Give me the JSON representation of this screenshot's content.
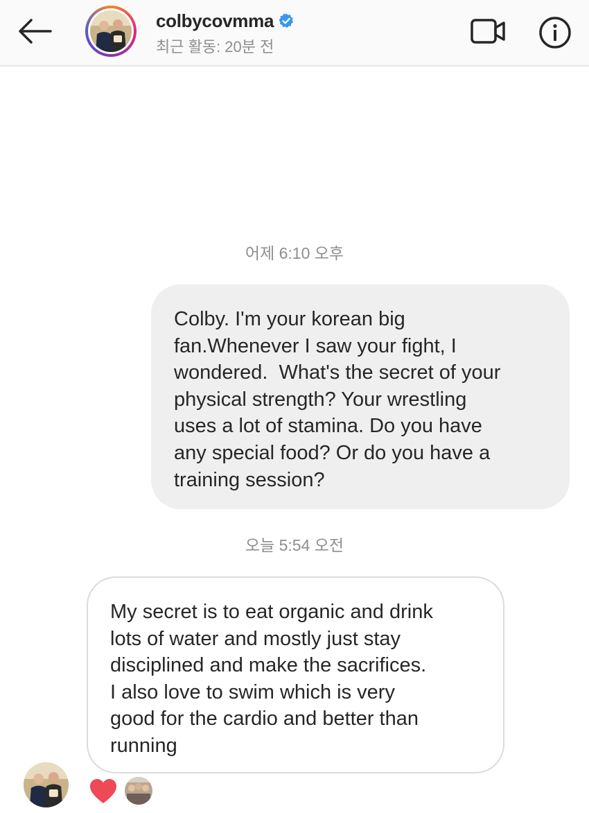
{
  "header": {
    "username": "colbycovmma",
    "verified": true,
    "activity": "최근 활동: 20분 전",
    "icons": {
      "back": "arrow-left-icon",
      "video": "video-call-icon",
      "info": "info-icon",
      "verified": "verified-badge-icon"
    }
  },
  "conversation": {
    "timestamp_1": "어제 6:10 오후",
    "sent_message": "Colby. I'm your korean big\nfan.Whenever I saw your fight, I\nwondered.  What's the secret of your\nphysical strength? Your wrestling\nuses a lot of stamina. Do you have\nany special food? Or do you have a\ntraining session?",
    "timestamp_2": "오늘 5:54 오전",
    "received_message": "My secret is to eat organic and drink\nlots of water and mostly just stay\ndisciplined and make the sacrifices.\nI also love to swim which is very\ngood for the cardio and better than\nrunning",
    "reaction": "heart-icon"
  },
  "colors": {
    "sent_bubble": "#efefef",
    "received_border": "#dbdbdb",
    "heart": "#ed4956",
    "verified": "#3897f0",
    "muted_text": "#8e8e8e"
  }
}
